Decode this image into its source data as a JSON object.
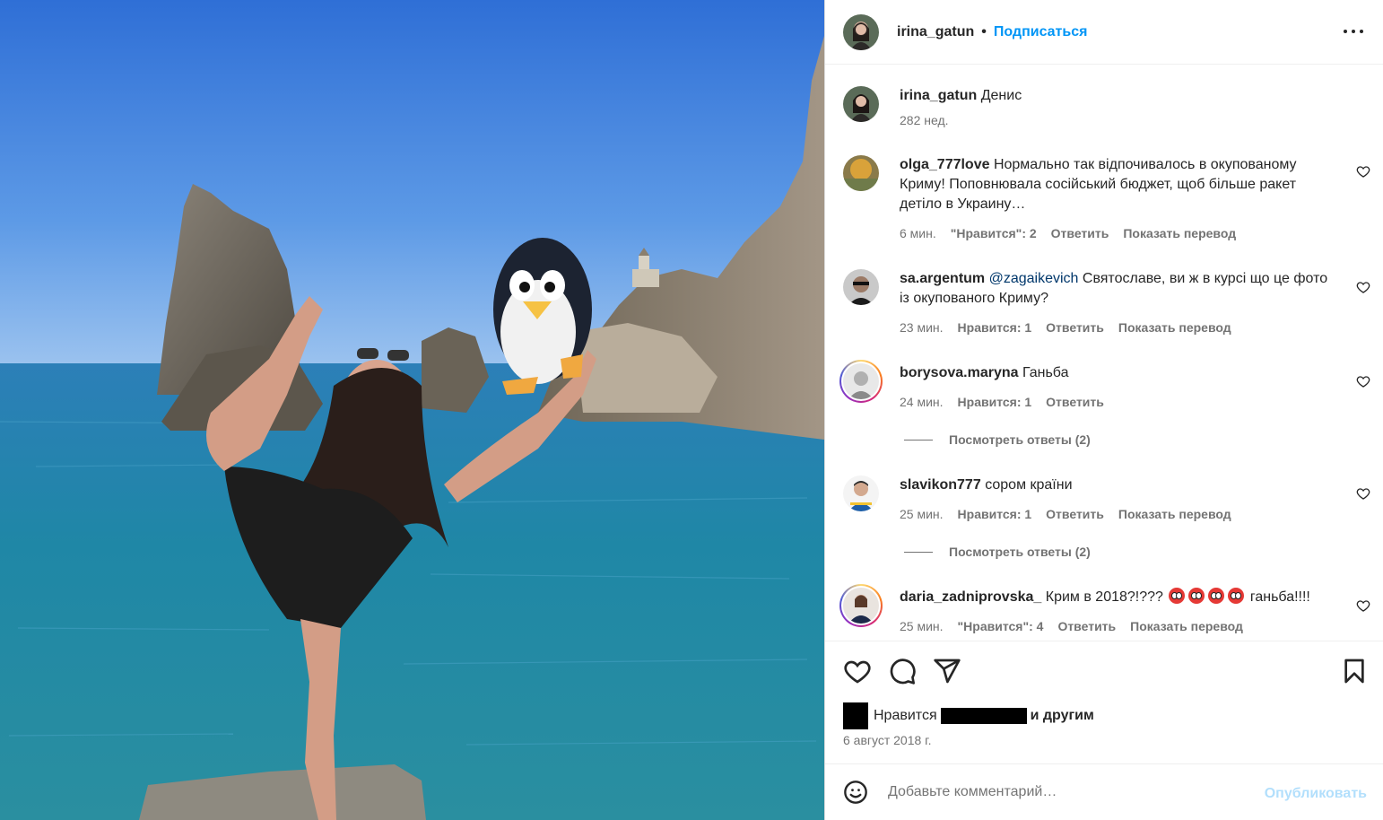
{
  "post": {
    "author": "irina_gatun",
    "follow_label": "Подписаться",
    "more_icon": "more-horizontal-icon",
    "caption": "Денис",
    "caption_time": "282 нед.",
    "date": "6 август 2018 г.",
    "likes_prefix": "Нравится",
    "likes_suffix": "и другим",
    "add_comment_placeholder": "Добавьте комментарий…",
    "publish_label": "Опубликовать",
    "colors": {
      "accent": "#0095f6",
      "publish_disabled": "#b2dffc",
      "mention": "#00376b"
    }
  },
  "comments": [
    {
      "user": "olga_777love",
      "text": "Нормально так відпочивалось в окупованому Криму! Поповнювала сосійський бюджет, щоб більше ракет детіло в Украину…",
      "time": "6 мин.",
      "likes": "\"Нравится\": 2",
      "reply": "Ответить",
      "translate": "Показать перевод"
    },
    {
      "user": "sa.argentum",
      "mention": "@zagaikevich",
      "text": "Святославе, ви ж в курсі що це фото із окупованого Криму?",
      "time": "23 мин.",
      "likes": "Нравится: 1",
      "reply": "Ответить",
      "translate": "Показать перевод"
    },
    {
      "user": "borysova.maryna",
      "text": "Ганьба",
      "time": "24 мин.",
      "likes": "Нравится: 1",
      "reply": "Ответить",
      "replies": "Посмотреть ответы (2)"
    },
    {
      "user": "slavikon777",
      "text": "сором країни",
      "time": "25 мин.",
      "likes": "Нравится: 1",
      "reply": "Ответить",
      "translate": "Показать перевод",
      "replies": "Посмотреть ответы (2)"
    },
    {
      "user": "daria_zadniprovska_",
      "text": "Крим в 2018?!???",
      "text_after": "ганьба!!!!",
      "time": "25 мин.",
      "likes": "\"Нравится\": 4",
      "reply": "Ответить",
      "translate": "Показать перевод"
    }
  ]
}
